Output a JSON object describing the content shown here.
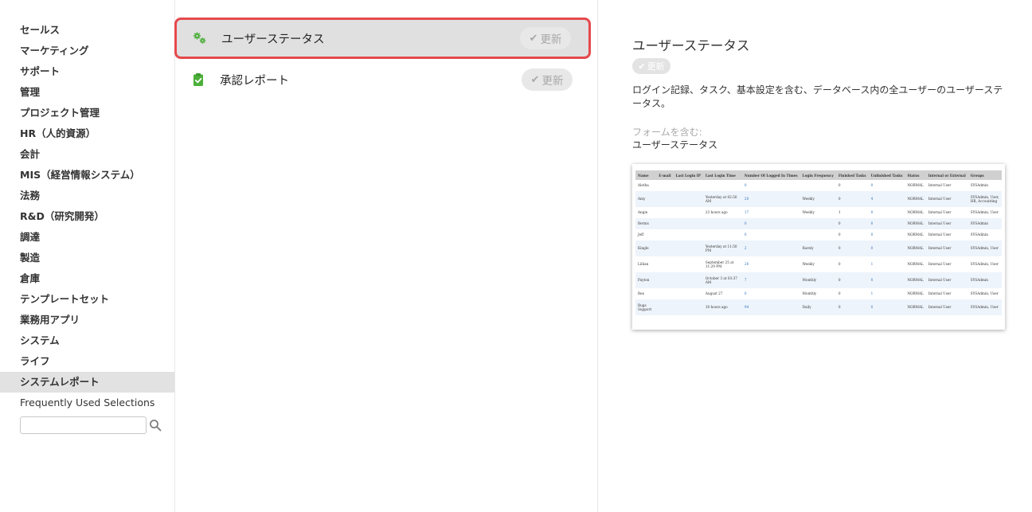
{
  "sidebar": {
    "categories": [
      "セールス",
      "マーケティング",
      "サポート",
      "管理",
      "プロジェクト管理",
      "HR（人的資源）",
      "会計",
      "MIS（経営情報システム）",
      "法務",
      "R&D（研究開発）",
      "調達",
      "製造",
      "倉庫",
      "テンプレートセット",
      "業務用アプリ",
      "システム",
      "ライフ",
      "システムレポート"
    ],
    "active_category": "システムレポート",
    "frequent_label": "Frequently Used Selections",
    "search_value": ""
  },
  "reports": [
    {
      "title": "ユーザーステータス",
      "icon": "gears-icon",
      "update_label": "更新",
      "selected": true
    },
    {
      "title": "承認レポート",
      "icon": "clipboard-check-icon",
      "update_label": "更新",
      "selected": false
    }
  ],
  "detail": {
    "title": "ユーザーステータス",
    "badge": "更新",
    "description": "ログイン記録、タスク、基本設定を含む、データベース内の全ユーザーのユーザーステータス。",
    "form_label": "フォームを含む:",
    "form_value": "ユーザーステータス",
    "preview": {
      "headers": [
        "Name",
        "E-mail",
        "Last Login IP",
        "Last Login Time",
        "Number Of Logged In Times",
        "Login Frequency",
        "Finished Tasks",
        "Unfinished Tasks",
        "Status",
        "Internal or External",
        "Groups"
      ],
      "rows": [
        [
          "Aletha",
          "",
          "",
          "",
          "0",
          "",
          "0",
          "0",
          "NORMAL",
          "Internal User",
          "SYSAdmin"
        ],
        [
          "Amy",
          "",
          "",
          "Yesterday at 02:50 AM",
          "20",
          "Weekly",
          "0",
          "4",
          "NORMAL",
          "Internal User",
          "SYSAdmin, User, HR, Accounting"
        ],
        [
          "Angie",
          "",
          "",
          "23 hours ago",
          "17",
          "Weekly",
          "1",
          "0",
          "NORMAL",
          "Internal User",
          "SYSAdmin, User"
        ],
        [
          "Bernis",
          "",
          "",
          "",
          "0",
          "",
          "0",
          "0",
          "NORMAL",
          "Internal User",
          "SYSAdmin"
        ],
        [
          "Jeff",
          "",
          "",
          "",
          "0",
          "",
          "0",
          "0",
          "NORMAL",
          "Internal User",
          "SYSAdmin"
        ],
        [
          "Kingle",
          "",
          "",
          "Yesterday at 11:50 PM",
          "2",
          "Rarely",
          "0",
          "0",
          "NORMAL",
          "Internal User",
          "SYSAdmin, User"
        ],
        [
          "Lillian",
          "",
          "",
          "September 25 at 11:29 PM",
          "20",
          "Weekly",
          "0",
          "1",
          "NORMAL",
          "Internal User",
          "SYSAdmin, User"
        ],
        [
          "Payton",
          "",
          "",
          "October 3 at 03:37 AM",
          "7",
          "Monthly",
          "0",
          "0",
          "NORMAL",
          "Internal User",
          "SYSAdmin"
        ],
        [
          "Rex",
          "",
          "",
          "August 27",
          "0",
          "Monthly",
          "0",
          "1",
          "NORMAL",
          "Internal User",
          "SYSAdmin, User"
        ],
        [
          "Bugs Support",
          "",
          "",
          "10 hours ago",
          "94",
          "Daily",
          "0",
          "0",
          "NORMAL",
          "Internal User",
          "SYSAdmin, User"
        ]
      ]
    }
  },
  "colors": {
    "selected_border": "#e5494c",
    "active_bg": "#e2e2e2",
    "icon_green": "#4caf3a",
    "link_blue": "#2c6fbb"
  }
}
